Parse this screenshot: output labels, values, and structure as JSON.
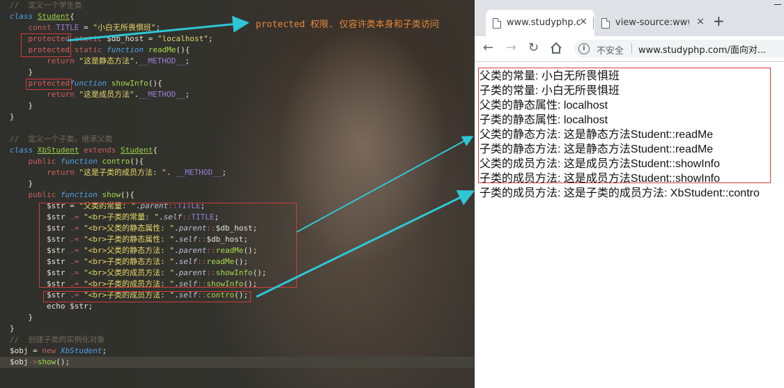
{
  "editor": {
    "lines": [
      [
        [
          "cm",
          "//  定义一个学生类"
        ]
      ],
      [
        [
          "kw",
          "class"
        ],
        [
          "var",
          " "
        ],
        [
          "cls",
          "Student"
        ],
        [
          "var",
          "{"
        ]
      ],
      [
        [
          "var",
          "    "
        ],
        [
          "op",
          "const"
        ],
        [
          "var",
          " "
        ],
        [
          "cst",
          "TITLE"
        ],
        [
          "var",
          " = "
        ],
        [
          "str",
          "\"小白无所畏惧班\""
        ],
        [
          "var",
          ";"
        ]
      ],
      [
        [
          "var",
          "    "
        ],
        [
          "prot",
          "protected"
        ],
        [
          "var",
          " "
        ],
        [
          "op",
          "static"
        ],
        [
          "var",
          " $db_host = "
        ],
        [
          "str",
          "\"localhost\""
        ],
        [
          "var",
          ";"
        ]
      ],
      [
        [
          "var",
          "    "
        ],
        [
          "prot",
          "protected"
        ],
        [
          "var",
          " "
        ],
        [
          "op",
          "static"
        ],
        [
          "var",
          " "
        ],
        [
          "kw",
          "function"
        ],
        [
          "var",
          " "
        ],
        [
          "fn",
          "readMe"
        ],
        [
          "var",
          "(){"
        ]
      ],
      [
        [
          "var",
          "        "
        ],
        [
          "ret",
          "return"
        ],
        [
          "var",
          " "
        ],
        [
          "str",
          "\"这是静态方法\""
        ],
        [
          "var",
          "."
        ],
        [
          "cst",
          "__METHOD__"
        ],
        [
          "var",
          ";"
        ]
      ],
      [
        [
          "var",
          "    }"
        ]
      ],
      [
        [
          "var",
          "    "
        ],
        [
          "prot",
          "protected"
        ],
        [
          "kw",
          "function"
        ],
        [
          "var",
          " "
        ],
        [
          "fn",
          "showInfo"
        ],
        [
          "var",
          "(){"
        ]
      ],
      [
        [
          "var",
          "        "
        ],
        [
          "ret",
          "return"
        ],
        [
          "var",
          " "
        ],
        [
          "str",
          "\"这是成员方法\""
        ],
        [
          "var",
          "."
        ],
        [
          "cst",
          "__METHOD__"
        ],
        [
          "var",
          ";"
        ]
      ],
      [
        [
          "var",
          "    }"
        ]
      ],
      [
        [
          "var",
          "}"
        ]
      ],
      [
        [
          "var",
          ""
        ]
      ],
      [
        [
          "cm",
          "//  定义一个子类，继承父类"
        ]
      ],
      [
        [
          "kw",
          "class"
        ],
        [
          "var",
          " "
        ],
        [
          "cls",
          "XbStudent"
        ],
        [
          "var",
          " "
        ],
        [
          "op",
          "extends"
        ],
        [
          "var",
          " "
        ],
        [
          "cls",
          "Student"
        ],
        [
          "var",
          "{"
        ]
      ],
      [
        [
          "var",
          "    "
        ],
        [
          "op",
          "public"
        ],
        [
          "var",
          " "
        ],
        [
          "kw",
          "function"
        ],
        [
          "var",
          " "
        ],
        [
          "fn",
          "contro"
        ],
        [
          "var",
          "(){"
        ]
      ],
      [
        [
          "var",
          "        "
        ],
        [
          "ret",
          "return"
        ],
        [
          "var",
          " "
        ],
        [
          "str",
          "\"这是子类的成员方法: \""
        ],
        [
          "var",
          ". "
        ],
        [
          "cst",
          "__METHOD__"
        ],
        [
          "var",
          ";"
        ]
      ],
      [
        [
          "var",
          "    }"
        ]
      ],
      [
        [
          "var",
          "    "
        ],
        [
          "op",
          "public"
        ],
        [
          "var",
          " "
        ],
        [
          "kw",
          "function"
        ],
        [
          "var",
          " "
        ],
        [
          "fn",
          "show"
        ],
        [
          "var",
          "(){"
        ]
      ],
      [
        [
          "var",
          "        $str = "
        ],
        [
          "str",
          "\"父类的常量: \""
        ],
        [
          "var",
          "."
        ],
        [
          "scope",
          "parent"
        ],
        [
          "op",
          "::"
        ],
        [
          "cst",
          "TITLE"
        ],
        [
          "var",
          ";"
        ]
      ],
      [
        [
          "var",
          "        $str "
        ],
        [
          "op",
          ".="
        ],
        [
          "var",
          " "
        ],
        [
          "str",
          "\"<br>子类的常量: \""
        ],
        [
          "var",
          "."
        ],
        [
          "scope",
          "self"
        ],
        [
          "op",
          "::"
        ],
        [
          "cst",
          "TITLE"
        ],
        [
          "var",
          ";"
        ]
      ],
      [
        [
          "var",
          "        $str "
        ],
        [
          "op",
          ".="
        ],
        [
          "var",
          " "
        ],
        [
          "str",
          "\"<br>父类的静态属性: \""
        ],
        [
          "var",
          "."
        ],
        [
          "scope",
          "parent"
        ],
        [
          "op",
          "::"
        ],
        [
          "var",
          "$db_host;"
        ]
      ],
      [
        [
          "var",
          "        $str "
        ],
        [
          "op",
          ".="
        ],
        [
          "var",
          " "
        ],
        [
          "str",
          "\"<br>子类的静态属性: \""
        ],
        [
          "var",
          "."
        ],
        [
          "scope",
          "self"
        ],
        [
          "op",
          "::"
        ],
        [
          "var",
          "$db_host;"
        ]
      ],
      [
        [
          "var",
          "        $str "
        ],
        [
          "op",
          ".="
        ],
        [
          "var",
          " "
        ],
        [
          "str",
          "\"<br>父类的静态方法: \""
        ],
        [
          "var",
          "."
        ],
        [
          "scope",
          "parent"
        ],
        [
          "op",
          "::"
        ],
        [
          "fn",
          "readMe"
        ],
        [
          "var",
          "();"
        ]
      ],
      [
        [
          "var",
          "        $str "
        ],
        [
          "op",
          ".="
        ],
        [
          "var",
          " "
        ],
        [
          "str",
          "\"<br>子类的静态方法: \""
        ],
        [
          "var",
          "."
        ],
        [
          "scope",
          "self"
        ],
        [
          "op",
          "::"
        ],
        [
          "fn",
          "readMe"
        ],
        [
          "var",
          "();"
        ]
      ],
      [
        [
          "var",
          "        $str "
        ],
        [
          "op",
          ".="
        ],
        [
          "var",
          " "
        ],
        [
          "str",
          "\"<br>父类的成员方法: \""
        ],
        [
          "var",
          "."
        ],
        [
          "scope",
          "parent"
        ],
        [
          "op",
          "::"
        ],
        [
          "fn",
          "showInfo"
        ],
        [
          "var",
          "();"
        ]
      ],
      [
        [
          "var",
          "        $str "
        ],
        [
          "op",
          ".="
        ],
        [
          "var",
          " "
        ],
        [
          "str",
          "\"<br>子类的成员方法: \""
        ],
        [
          "var",
          "."
        ],
        [
          "scope",
          "self"
        ],
        [
          "op",
          "::"
        ],
        [
          "fn",
          "showInfo"
        ],
        [
          "var",
          "();"
        ]
      ],
      [
        [
          "var",
          "        $str "
        ],
        [
          "op",
          ".="
        ],
        [
          "var",
          " "
        ],
        [
          "str",
          "\"<br>子类的成员方法: \""
        ],
        [
          "var",
          "."
        ],
        [
          "scope",
          "self"
        ],
        [
          "op",
          "::"
        ],
        [
          "fn",
          "contro"
        ],
        [
          "var",
          "();"
        ]
      ],
      [
        [
          "var",
          "        echo $str;"
        ]
      ],
      [
        [
          "var",
          "    }"
        ]
      ],
      [
        [
          "var",
          "}"
        ]
      ],
      [
        [
          "cm",
          "//  创建子类的实例化对象"
        ]
      ],
      [
        [
          "var",
          "$obj = "
        ],
        [
          "op",
          "new"
        ],
        [
          "var",
          " "
        ],
        [
          "kw",
          "XbStudent"
        ],
        [
          "var",
          ";"
        ]
      ],
      [
        [
          "var",
          "$obj"
        ],
        [
          "op",
          "->"
        ],
        [
          "fn",
          "show"
        ],
        [
          "var",
          "();"
        ]
      ]
    ],
    "annotation": "protected 权限. 仅容许类本身和子类访问"
  },
  "browser": {
    "tabs": [
      {
        "title": "www.studyphp.c",
        "close": "×"
      },
      {
        "title": "view-source:www.",
        "close": "×"
      }
    ],
    "new_tab": "+",
    "security_label": "不安全",
    "url": "www.studyphp.com/面向对...",
    "output_lines": [
      "父类的常量: 小白无所畏惧班",
      "子类的常量: 小白无所畏惧班",
      "父类的静态属性: localhost",
      "子类的静态属性: localhost",
      "父类的静态方法: 这是静态方法Student::readMe",
      "子类的静态方法: 这是静态方法Student::readMe",
      "父类的成员方法: 这是成员方法Student::showInfo",
      "子类的成员方法: 这是成员方法Student::showInfo",
      "子类的成员方法: 这是子类的成员方法: XbStudent::contro"
    ]
  },
  "colors": {
    "highlight_box": "#d63b3b",
    "arrow": "#2ec6d6",
    "annotation": "#e8873a"
  }
}
